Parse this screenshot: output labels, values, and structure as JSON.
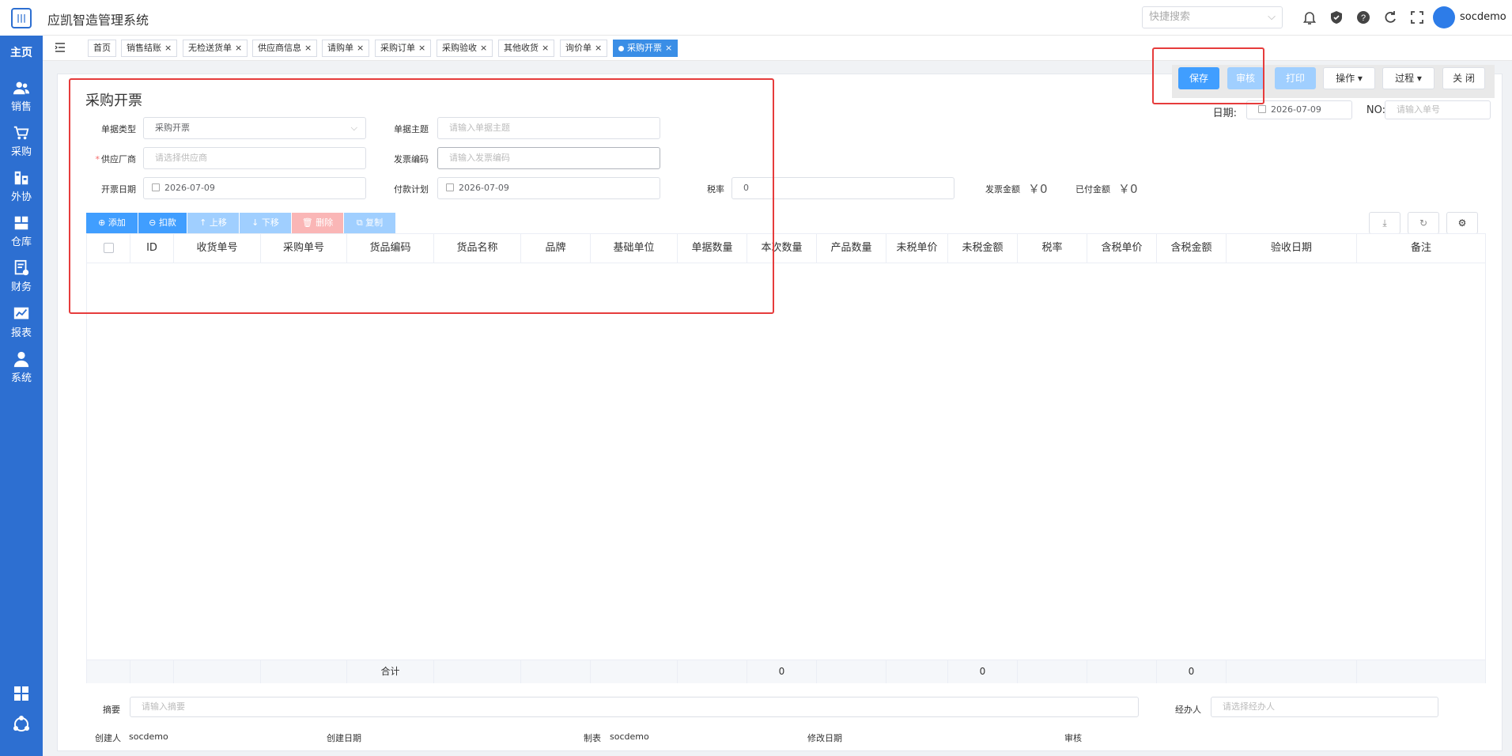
{
  "app": {
    "title": "应凯智造管理系统",
    "username": "socdemo"
  },
  "sidebar": {
    "home": "主页",
    "items": [
      {
        "label": "销售",
        "icon": "users-icon"
      },
      {
        "label": "采购",
        "icon": "cart-icon"
      },
      {
        "label": "外协",
        "icon": "factory-icon"
      },
      {
        "label": "仓库",
        "icon": "warehouse-icon"
      },
      {
        "label": "财务",
        "icon": "finance-icon"
      },
      {
        "label": "报表",
        "icon": "chart-icon"
      },
      {
        "label": "系统",
        "icon": "user-icon"
      }
    ]
  },
  "header": {
    "quick_search_placeholder": "快捷搜索"
  },
  "tabs": [
    {
      "label": "首页",
      "closable": false
    },
    {
      "label": "销售结账",
      "closable": true
    },
    {
      "label": "无检送货单",
      "closable": true
    },
    {
      "label": "供应商信息",
      "closable": true
    },
    {
      "label": "请购单",
      "closable": true
    },
    {
      "label": "采购订单",
      "closable": true
    },
    {
      "label": "采购验收",
      "closable": true
    },
    {
      "label": "其他收货",
      "closable": true
    },
    {
      "label": "询价单",
      "closable": true
    },
    {
      "label": "采购开票",
      "closable": true,
      "active": true
    }
  ],
  "page": {
    "title": "采购开票"
  },
  "actions": {
    "save": "保存",
    "audit": "审核",
    "print": "打印",
    "operate": "操作",
    "process": "过程",
    "close": "关 闭"
  },
  "form": {
    "date_label": "日期:",
    "date_value": "2026-07-09",
    "no_label": "NO:",
    "no_placeholder": "请输入单号",
    "doc_type_label": "单据类型",
    "doc_type_value": "采购开票",
    "subject_label": "单据主题",
    "subject_placeholder": "请输入单据主题",
    "supplier_label": "供应厂商",
    "supplier_placeholder": "请选择供应商",
    "invoice_code_label": "发票编码",
    "invoice_code_placeholder": "请输入发票编码",
    "invoice_date_label": "开票日期",
    "invoice_date_value": "2026-07-09",
    "payment_plan_label": "付款计划",
    "payment_plan_value": "2026-07-09",
    "tax_rate_label": "税率",
    "tax_rate_value": "0",
    "invoice_amount_label": "发票金额",
    "invoice_amount_value": "￥0",
    "paid_amount_label": "已付金额",
    "paid_amount_value": "￥0"
  },
  "toolbar": {
    "add": "添加",
    "deduct": "扣款",
    "move_up": "上移",
    "move_down": "下移",
    "delete": "删除",
    "copy": "复制"
  },
  "table": {
    "columns": [
      "ID",
      "收货单号",
      "采购单号",
      "货品编码",
      "货品名称",
      "品牌",
      "基础单位",
      "单据数量",
      "本次数量",
      "产品数量",
      "未税单价",
      "未税金额",
      "税率",
      "含税单价",
      "含税金额",
      "验收日期",
      "备注"
    ],
    "footer": {
      "total_label": "合计",
      "this_qty_total": "0",
      "untaxed_amount_total": "0",
      "taxed_amount_total": "0"
    }
  },
  "bottom": {
    "summary_label": "摘要",
    "summary_placeholder": "请输入摘要",
    "handler_label": "经办人",
    "handler_placeholder": "请选择经办人",
    "creator_label": "创建人",
    "creator_value": "socdemo",
    "create_date_label": "创建日期",
    "maker_label": "制表",
    "maker_value": "socdemo",
    "modify_date_label": "修改日期",
    "audit_label": "审核"
  },
  "colors": {
    "sidebar": "#2d6fd1",
    "primary": "#409eff",
    "highlight": "#e63c3c"
  }
}
